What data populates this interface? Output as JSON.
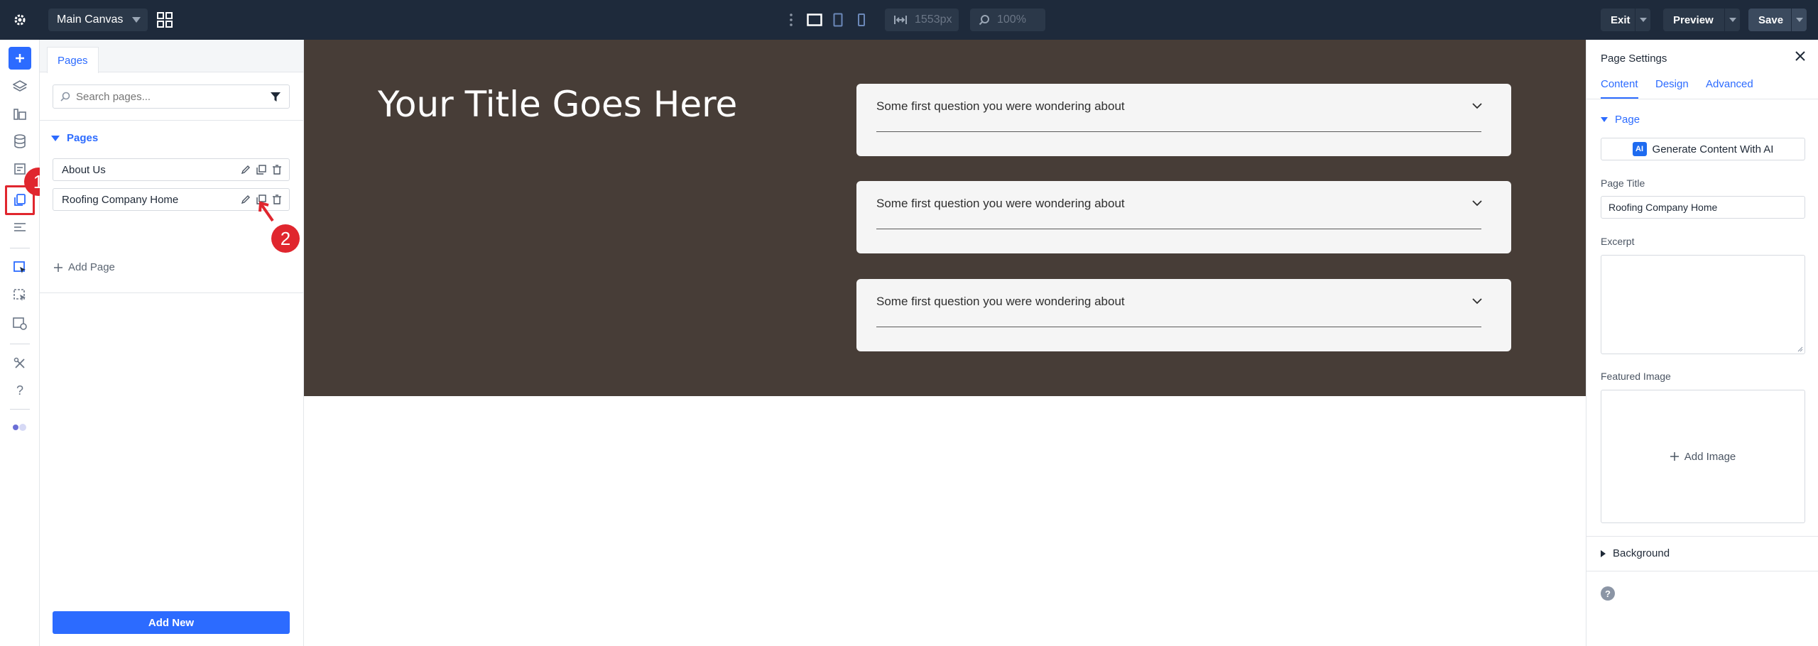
{
  "topbar": {
    "canvas_select": "Main Canvas",
    "width_value": "1553px",
    "zoom_value": "100%",
    "exit_label": "Exit",
    "preview_label": "Preview",
    "save_label": "Save"
  },
  "rail": {
    "icons": [
      "plus-icon",
      "layers-icon",
      "library-icon",
      "database-icon",
      "forms-icon",
      "pages-icon",
      "list-icon",
      "theme-builder-icon",
      "templates-icon",
      "preview-icon",
      "tools-icon",
      "help-icon",
      "toggle-icon"
    ],
    "badge_1": "1",
    "badge_2": "2"
  },
  "pages_panel": {
    "tab": "Pages",
    "search_placeholder": "Search pages...",
    "section_title": "Pages",
    "pages": [
      {
        "label": "About Us"
      },
      {
        "label": "Roofing Company Home"
      }
    ],
    "add_page": "Add Page",
    "add_new": "Add New"
  },
  "canvas": {
    "hero_title": "Your Title Goes Here",
    "faq": [
      {
        "question": "Some first question you were wondering about"
      },
      {
        "question": "Some first question you were wondering about"
      },
      {
        "question": "Some first question you were wondering about"
      }
    ],
    "colors": {
      "hero_bg": "#473d37",
      "faq_bg": "#f5f5f5"
    }
  },
  "page_settings": {
    "title": "Page Settings",
    "tabs": [
      "Content",
      "Design",
      "Advanced"
    ],
    "page_section": "Page",
    "generate_button": "Generate Content With AI",
    "ai_badge": "AI",
    "page_title_label": "Page Title",
    "page_title_value": "Roofing Company Home",
    "excerpt_label": "Excerpt",
    "featured_image_label": "Featured Image",
    "add_image": "Add Image",
    "background_section": "Background",
    "help": "?"
  },
  "colors": {
    "accent": "#2c6bff",
    "topbar": "#1e2a3b",
    "annotation_red": "#e0262e"
  }
}
